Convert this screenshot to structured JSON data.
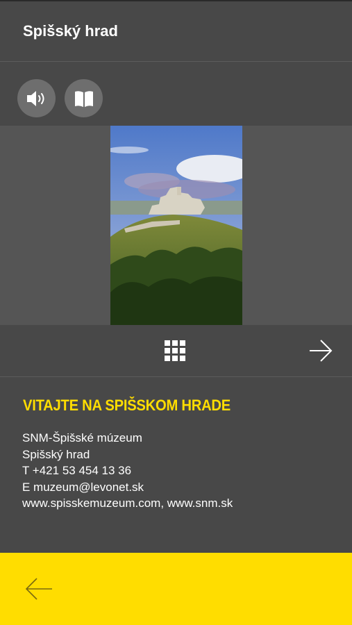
{
  "header": {
    "title": "Spišský hrad"
  },
  "toolbar": {
    "audio_button_icon": "speaker-icon",
    "book_button_icon": "open-book-icon"
  },
  "viewer": {
    "image_icon": "castle-photo"
  },
  "nav": {
    "grid_icon": "grid-icon",
    "next_icon": "arrow-right-icon"
  },
  "info": {
    "heading": "VITAJTE NA SPIŠSKOM HRADE",
    "lines": [
      "SNM-Špišské múzeum",
      "Spišský hrad",
      "T +421 53 454 13 36",
      "E muzeum@levonet.sk",
      "www.spisskemuzeum.com, www.snm.sk"
    ]
  },
  "bottom": {
    "back_icon": "arrow-left-icon"
  },
  "colors": {
    "background": "#484848",
    "accent": "#ffdd00",
    "button": "#6e6e6e"
  }
}
